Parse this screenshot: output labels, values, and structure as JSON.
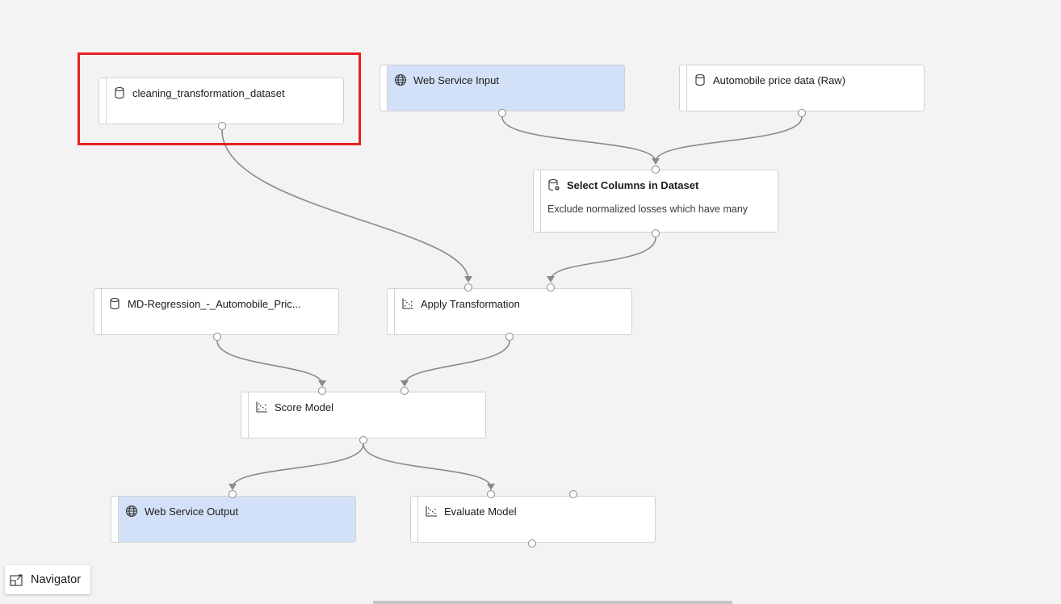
{
  "canvas": {
    "highlight_color": "#e8201d",
    "web_service_color": "#d3e1f8",
    "edge_color": "#8a8a8a"
  },
  "nodes": [
    {
      "id": "cleaning",
      "title": "cleaning_transformation_dataset",
      "icon": "dataset-icon",
      "highlighted": true
    },
    {
      "id": "web_input",
      "title": "Web Service Input",
      "icon": "globe-icon"
    },
    {
      "id": "auto_raw",
      "title": "Automobile price data (Raw)",
      "icon": "dataset-icon"
    },
    {
      "id": "select_cols",
      "title": "Select Columns in Dataset",
      "subtitle": "Exclude normalized losses which have many",
      "icon": "dataset-gear-icon"
    },
    {
      "id": "md_regression",
      "title": "MD-Regression_-_Automobile_Pric...",
      "icon": "dataset-icon"
    },
    {
      "id": "apply_transform",
      "title": "Apply Transformation",
      "icon": "scatter-icon"
    },
    {
      "id": "score_model",
      "title": "Score Model",
      "icon": "scatter-icon"
    },
    {
      "id": "web_output",
      "title": "Web Service Output",
      "icon": "globe-icon"
    },
    {
      "id": "evaluate_model",
      "title": "Evaluate Model",
      "icon": "scatter-icon"
    }
  ],
  "edges": [
    {
      "from": "cleaning",
      "to": "apply_transform",
      "to_port": "left"
    },
    {
      "from": "web_input",
      "to": "select_cols"
    },
    {
      "from": "auto_raw",
      "to": "select_cols"
    },
    {
      "from": "select_cols",
      "to": "apply_transform",
      "to_port": "right"
    },
    {
      "from": "md_regression",
      "to": "score_model",
      "to_port": "left"
    },
    {
      "from": "apply_transform",
      "to": "score_model",
      "to_port": "right"
    },
    {
      "from": "score_model",
      "to": "web_output"
    },
    {
      "from": "score_model",
      "to": "evaluate_model",
      "to_port": "left"
    }
  ],
  "navigator": {
    "label": "Navigator",
    "icon": "navigator-icon"
  }
}
